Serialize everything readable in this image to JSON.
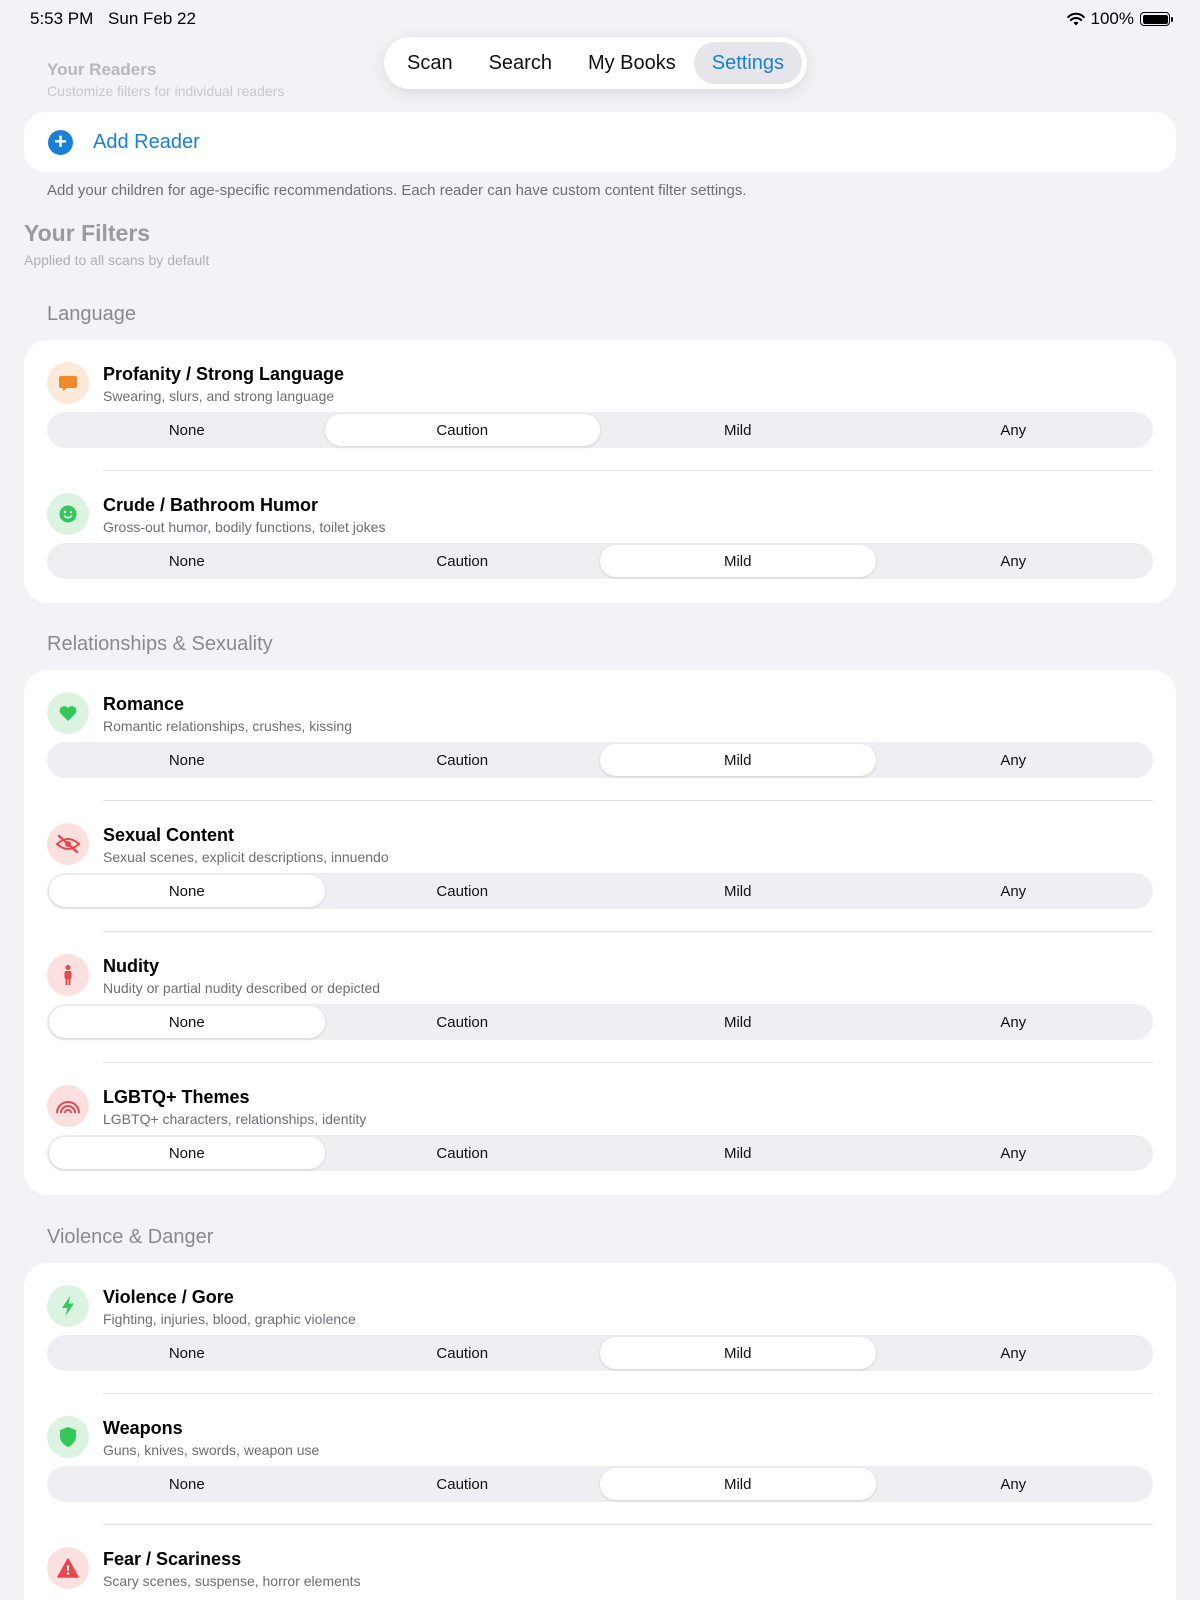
{
  "status": {
    "time": "5:53 PM",
    "date": "Sun Feb 22",
    "battery": "100%"
  },
  "tabs": [
    {
      "label": "Scan",
      "active": false
    },
    {
      "label": "Search",
      "active": false
    },
    {
      "label": "My Books",
      "active": false
    },
    {
      "label": "Settings",
      "active": true
    }
  ],
  "readers": {
    "title": "Your Readers",
    "subtitle": "Customize filters for individual readers",
    "add_label": "Add Reader",
    "footer": "Add your children for age-specific recommendations. Each reader can have custom content filter settings."
  },
  "filters": {
    "title": "Your Filters",
    "subtitle": "Applied to all scans by default"
  },
  "options": [
    "None",
    "Caution",
    "Mild",
    "Any"
  ],
  "colors": {
    "accent": "#1a7fd6",
    "orange": "#f0892a",
    "green": "#34c759",
    "red": "#e5484d"
  },
  "sections": [
    {
      "title": "Language",
      "items": [
        {
          "title": "Profanity / Strong Language",
          "desc": "Swearing, slurs, and strong language",
          "icon": "speech-bubble-icon",
          "selected": "Caution"
        },
        {
          "title": "Crude / Bathroom Humor",
          "desc": "Gross-out humor, bodily functions, toilet jokes",
          "icon": "smiley-icon",
          "selected": "Mild"
        }
      ]
    },
    {
      "title": "Relationships & Sexuality",
      "items": [
        {
          "title": "Romance",
          "desc": "Romantic relationships, crushes, kissing",
          "icon": "heart-icon",
          "selected": "Mild"
        },
        {
          "title": "Sexual Content",
          "desc": "Sexual scenes, explicit descriptions, innuendo",
          "icon": "eye-slash-icon",
          "selected": "None"
        },
        {
          "title": "Nudity",
          "desc": "Nudity or partial nudity described or depicted",
          "icon": "person-icon",
          "selected": "None"
        },
        {
          "title": "LGBTQ+ Themes",
          "desc": "LGBTQ+ characters, relationships, identity",
          "icon": "rainbow-icon",
          "selected": "None"
        }
      ]
    },
    {
      "title": "Violence & Danger",
      "items": [
        {
          "title": "Violence / Gore",
          "desc": "Fighting, injuries, blood, graphic violence",
          "icon": "bolt-icon",
          "selected": "Mild"
        },
        {
          "title": "Weapons",
          "desc": "Guns, knives, swords, weapon use",
          "icon": "shield-icon",
          "selected": "Mild"
        },
        {
          "title": "Fear / Scariness",
          "desc": "Scary scenes, suspense, horror elements",
          "icon": "warning-icon",
          "selected": ""
        }
      ]
    }
  ]
}
